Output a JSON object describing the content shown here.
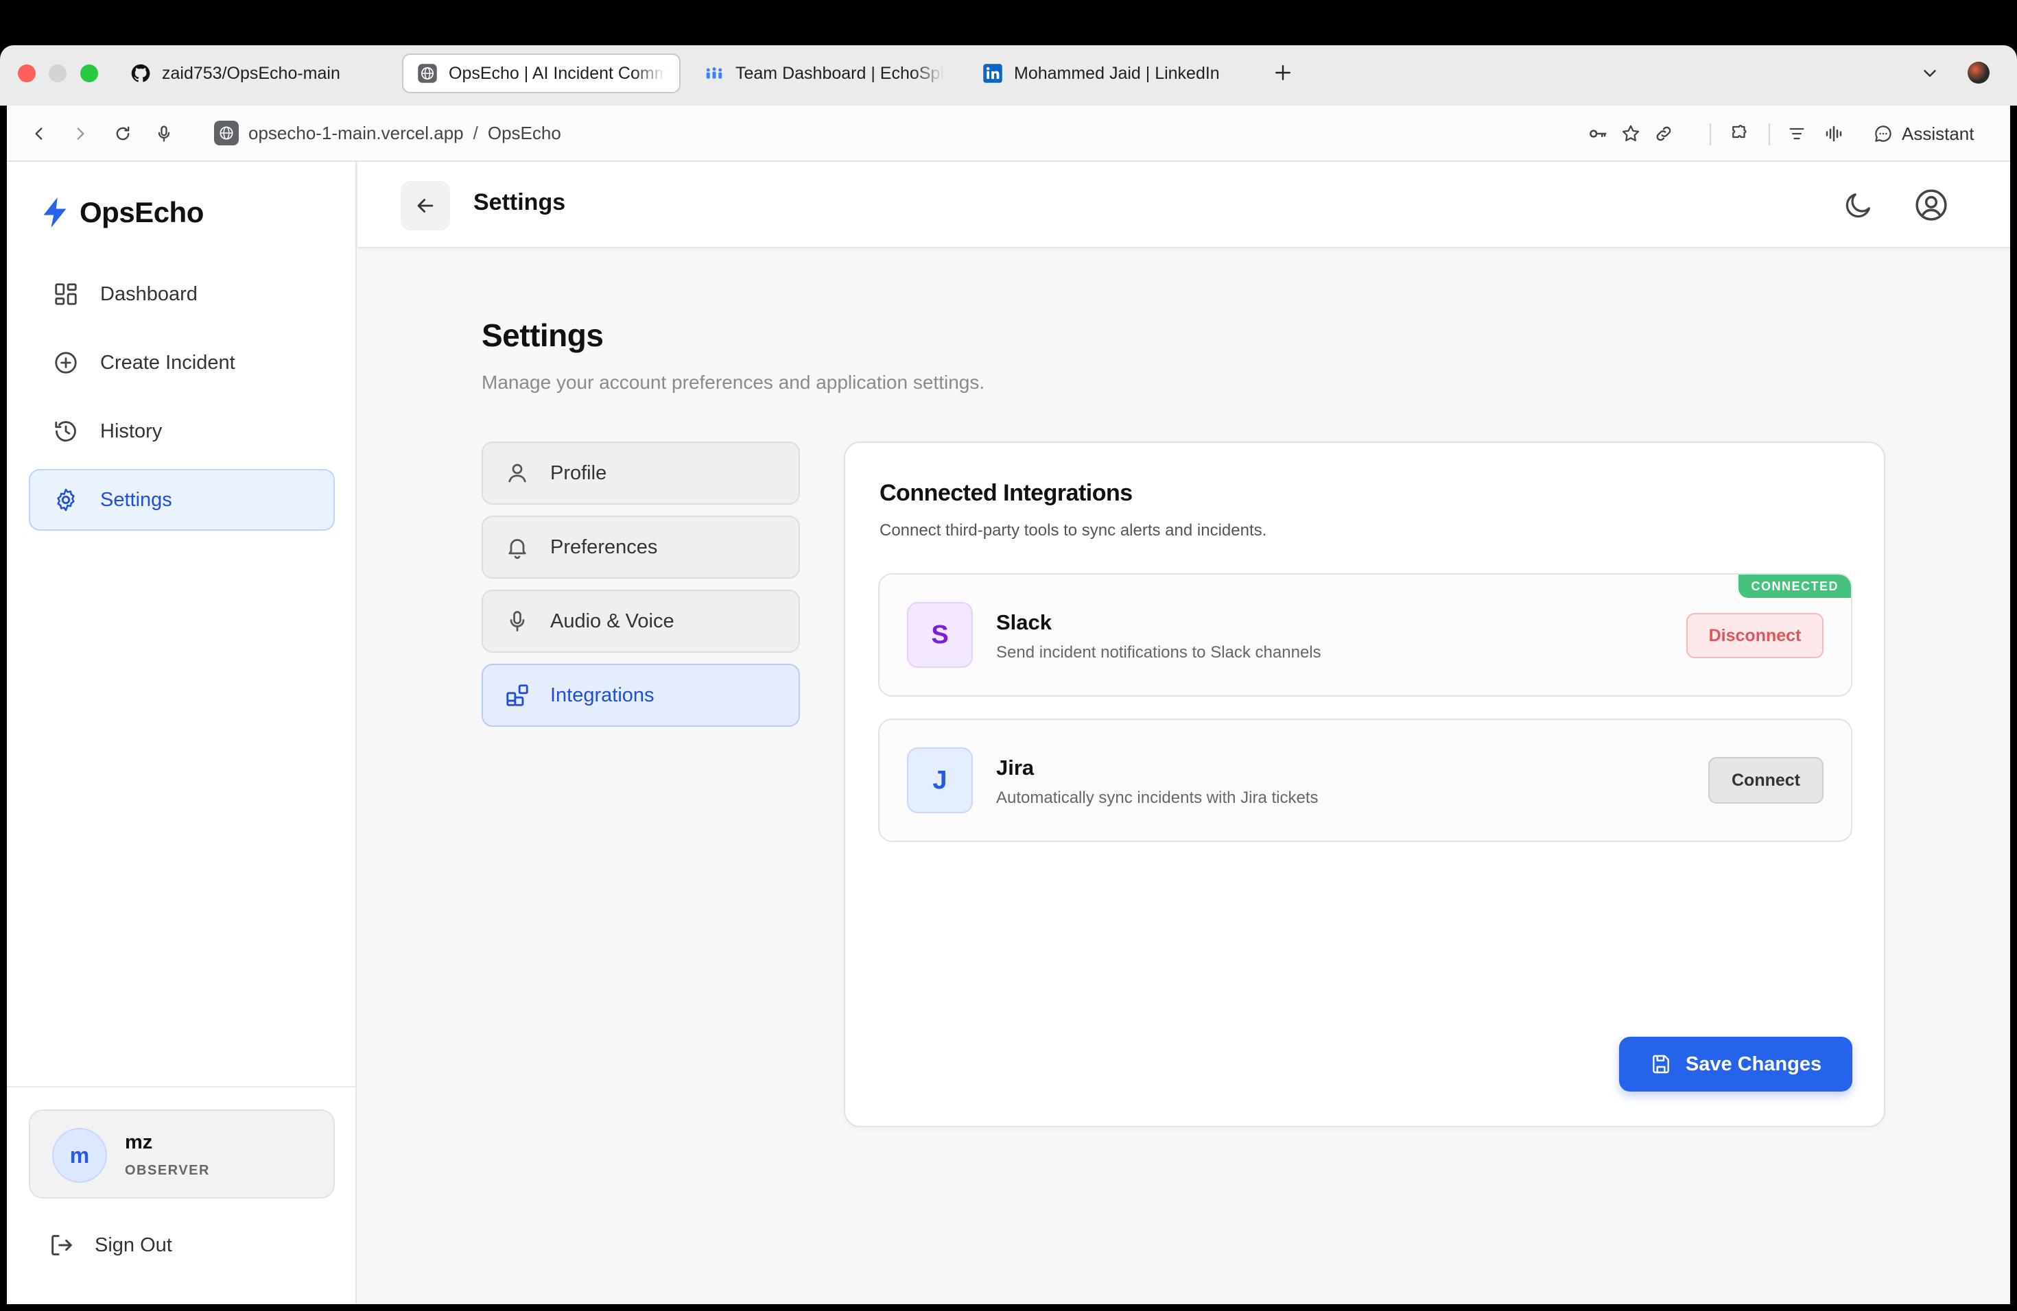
{
  "browser": {
    "tabs": [
      {
        "label": "zaid753/OpsEcho-main",
        "icon": "github-icon"
      },
      {
        "label": "OpsEcho | AI Incident Comm",
        "icon": "globe-icon",
        "active": true
      },
      {
        "label": "Team Dashboard | EchoSphe",
        "icon": "team-icon"
      },
      {
        "label": "Mohammed Jaid | LinkedIn",
        "icon": "linkedin-icon"
      }
    ],
    "url": "opsecho-1-main.vercel.app",
    "url_separator": "/",
    "page_title": "OpsEcho",
    "assistant_label": "Assistant"
  },
  "sidebar": {
    "brand": "OpsEcho",
    "items": [
      {
        "label": "Dashboard",
        "icon": "grid-icon"
      },
      {
        "label": "Create Incident",
        "icon": "plus-circle-icon"
      },
      {
        "label": "History",
        "icon": "history-icon"
      },
      {
        "label": "Settings",
        "icon": "gear-icon",
        "active": true
      }
    ],
    "user": {
      "initial": "m",
      "name": "mz",
      "role": "OBSERVER"
    },
    "signout_label": "Sign Out"
  },
  "header": {
    "title": "Settings"
  },
  "main": {
    "title": "Settings",
    "subtitle": "Manage your account preferences and application settings.",
    "tabs": [
      {
        "label": "Profile",
        "icon": "user-icon"
      },
      {
        "label": "Preferences",
        "icon": "bell-icon"
      },
      {
        "label": "Audio & Voice",
        "icon": "mic-icon"
      },
      {
        "label": "Integrations",
        "icon": "blocks-icon",
        "active": true
      }
    ],
    "card": {
      "title": "Connected Integrations",
      "subtitle": "Connect third-party tools to sync alerts and incidents.",
      "integrations": [
        {
          "initial": "S",
          "name": "Slack",
          "description": "Send incident notifications to Slack channels",
          "badge": "CONNECTED",
          "action": "Disconnect"
        },
        {
          "initial": "J",
          "name": "Jira",
          "description": "Automatically sync incidents with Jira tickets",
          "action": "Connect"
        }
      ],
      "save_label": "Save Changes"
    }
  },
  "colors": {
    "accent": "#2563eb",
    "active_bg": "#eaf2ff",
    "connected_badge": "#44c27e",
    "disconnect": "#e0555a"
  }
}
